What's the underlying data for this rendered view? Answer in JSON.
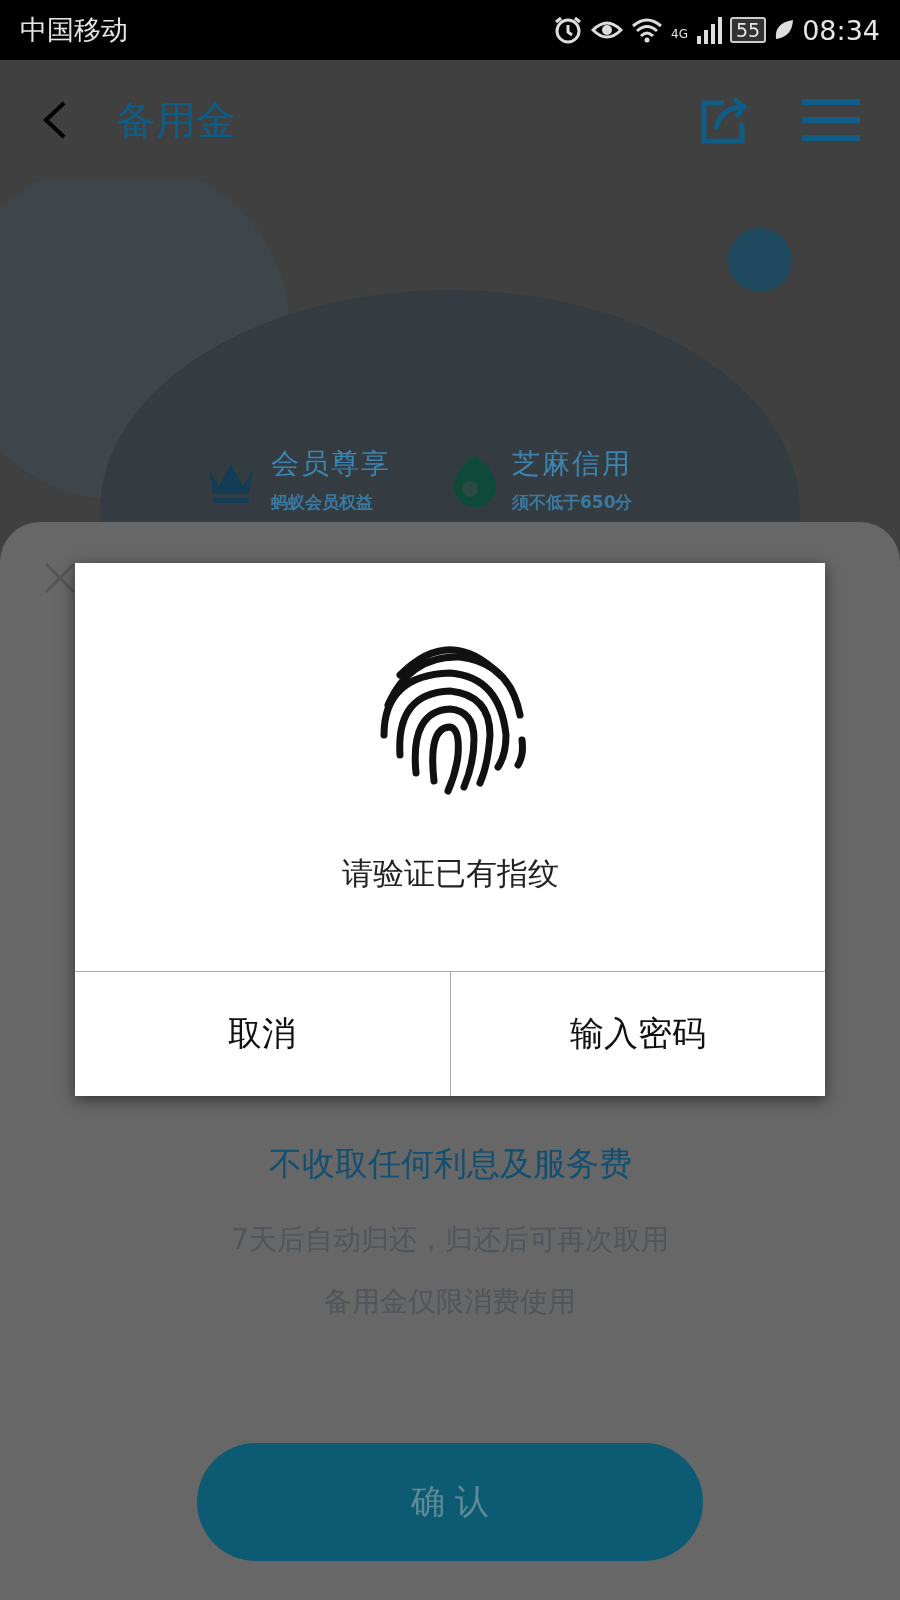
{
  "status_bar": {
    "carrier": "中国移动",
    "network": "4G",
    "battery": "55",
    "time": "08:34"
  },
  "header": {
    "title": "备用金"
  },
  "benefits": [
    {
      "kind": "crown",
      "title": "会员尊享",
      "subtitle": "蚂蚁会员权益"
    },
    {
      "kind": "drop",
      "title": "芝麻信用",
      "subtitle": "须不低于650分"
    }
  ],
  "sheet": {
    "headline": "不收取任何利息及服务费",
    "notes": [
      "7天后自动归还，归还后可再次取用",
      "备用金仅限消费使用"
    ],
    "confirm_button": "确 认"
  },
  "dialog": {
    "message": "请验证已有指纹",
    "buttons": [
      "取消",
      "输入密码"
    ]
  }
}
